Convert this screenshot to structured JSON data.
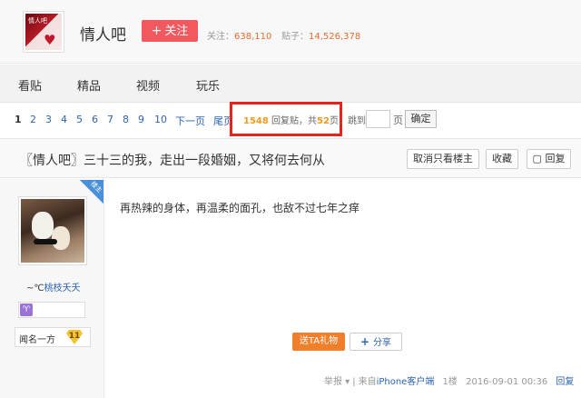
{
  "forum": {
    "name": "情人吧",
    "logo_text": "情人吧",
    "follow_label": "关注",
    "follow_count_label": "关注：",
    "follow_count": "638,110",
    "post_count_label": "贴子：",
    "post_count": "14,526,378"
  },
  "nav": {
    "items": [
      "看贴",
      "精品",
      "视频",
      "玩乐"
    ]
  },
  "pager": {
    "current": "1",
    "pages": [
      "2",
      "3",
      "4",
      "5",
      "6",
      "7",
      "8",
      "9",
      "10"
    ],
    "next": "下一页",
    "last": "尾页",
    "reply_count": "1548",
    "reply_label": "回复贴，共",
    "page_total": "52",
    "page_suffix": "页，",
    "jump_label": "跳到",
    "page_unit": "页",
    "confirm": "确定"
  },
  "thread": {
    "title": "〖情人吧〗三十三的我，走出一段婚姻，又将何去何从",
    "btn_owner_only": "取消只看楼主",
    "btn_collect": "收藏",
    "btn_reply": "回复"
  },
  "post": {
    "owner_badge": "楼主",
    "username_prefix": "~℃",
    "username": "桃枝夭夭",
    "level_symbol": "♈",
    "rank_title": "闻名一方",
    "rank_level": "11",
    "content": "再热辣的身体，再温柔的面孔，也敌不过七年之痒",
    "gift_label": "送TA礼物",
    "share_label": "分享",
    "report": "举报",
    "from_label": "来自",
    "from_client": "iPhone客户端",
    "floor": "1楼",
    "time": "2016-09-01 00:36",
    "reply": "回复"
  },
  "colors": {
    "accent_red": "#f1595f",
    "highlight_box": "#e8231b",
    "link_blue": "#2d64b3",
    "count_orange": "#e96c2d"
  }
}
